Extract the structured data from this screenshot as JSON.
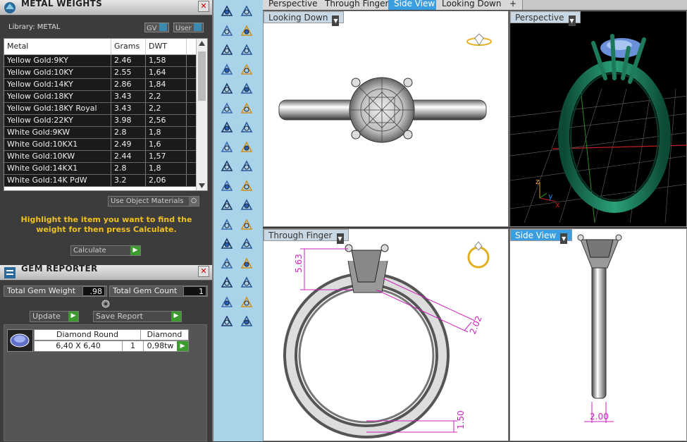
{
  "metal_panel": {
    "title": "METAL WEIGHTS",
    "library_label": "Library: METAL",
    "toggle_gv": "GV",
    "toggle_user": "User",
    "columns": [
      "Metal",
      "Grams",
      "DWT"
    ],
    "rows": [
      [
        "Yellow Gold:9KY",
        "2.46",
        "1,58"
      ],
      [
        "Yellow Gold:10KY",
        "2.55",
        "1,64"
      ],
      [
        "Yellow Gold:14KY",
        "2.86",
        "1,84"
      ],
      [
        "Yellow Gold:18KY",
        "3.43",
        "2,2"
      ],
      [
        "Yellow Gold:18KY Royal",
        "3.43",
        "2,2"
      ],
      [
        "Yellow Gold:22KY",
        "3.98",
        "2,56"
      ],
      [
        "White Gold:9KW",
        "2.8",
        "1,8"
      ],
      [
        "White Gold:10KX1",
        "2.49",
        "1,6"
      ],
      [
        "White Gold:10KW",
        "2.44",
        "1,57"
      ],
      [
        "White Gold:14KX1",
        "2.8",
        "1,8"
      ],
      [
        "White Gold:14K PdW",
        "3.2",
        "2,06"
      ]
    ],
    "use_object_materials": "Use Object Materials",
    "instructions": "Highlight the item you want to find the weight for then press Calculate.",
    "calculate_button": "Calculate"
  },
  "gem_panel": {
    "title": "GEM REPORTER",
    "total_gem_weight_label": "Total Gem Weight",
    "total_gem_weight_value": ".98",
    "total_gem_count_label": "Total Gem Count",
    "total_gem_count_value": "1",
    "update_button": "Update",
    "save_report_button": "Save Report",
    "gem": {
      "shape": "Diamond Round",
      "type": "Diamond",
      "size": "6,40 X 6,40",
      "count": "1",
      "weight": "0,98tw"
    }
  },
  "tabs": [
    "Perspective",
    "Through Finger",
    "Side View",
    "Looking Down",
    "+"
  ],
  "active_tab": "Side View",
  "viewports": {
    "top_left": "Looking Down",
    "top_right": "Perspective",
    "bottom_left": "Through Finger",
    "bottom_right": "Side View"
  },
  "dimensions": {
    "height": "5.63",
    "band_taper": "2.02",
    "band_thickness": "1.50",
    "side_width": "2.00"
  },
  "axes": {
    "z": "z",
    "y": "y",
    "x": "x"
  },
  "colors": {
    "accent": "#3a9ee0",
    "instruction_text": "#f0c020",
    "green_button": "#3c9a2e",
    "ring_green": "#1d7a5a",
    "dimension_magenta": "#d020c0"
  }
}
